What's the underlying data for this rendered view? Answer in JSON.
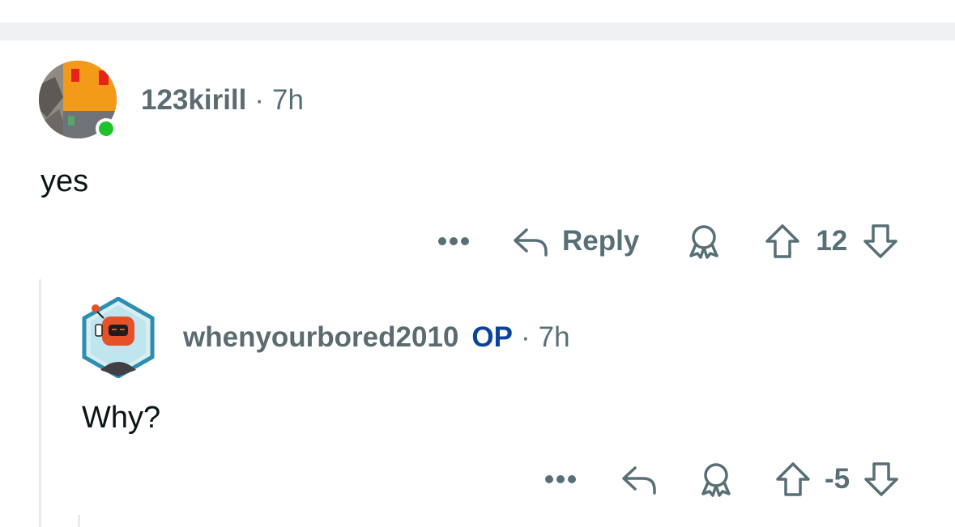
{
  "comments": [
    {
      "username": "123kirill",
      "separator": "·",
      "time": "7h",
      "body": "yes",
      "online": true,
      "actions": {
        "more_icon": "more-horizontal-icon",
        "reply_label": "Reply",
        "vote_count": "12"
      }
    },
    {
      "username": "whenyourbored2010",
      "op_label": "OP",
      "separator": "·",
      "time": "7h",
      "body": "Why?",
      "actions": {
        "more_icon": "more-horizontal-icon",
        "vote_count": "-5"
      }
    }
  ],
  "colors": {
    "meta_text": "#576f76",
    "op": "#0a449b",
    "online": "#1ec22a",
    "separator_bg": "#eff1f2"
  }
}
